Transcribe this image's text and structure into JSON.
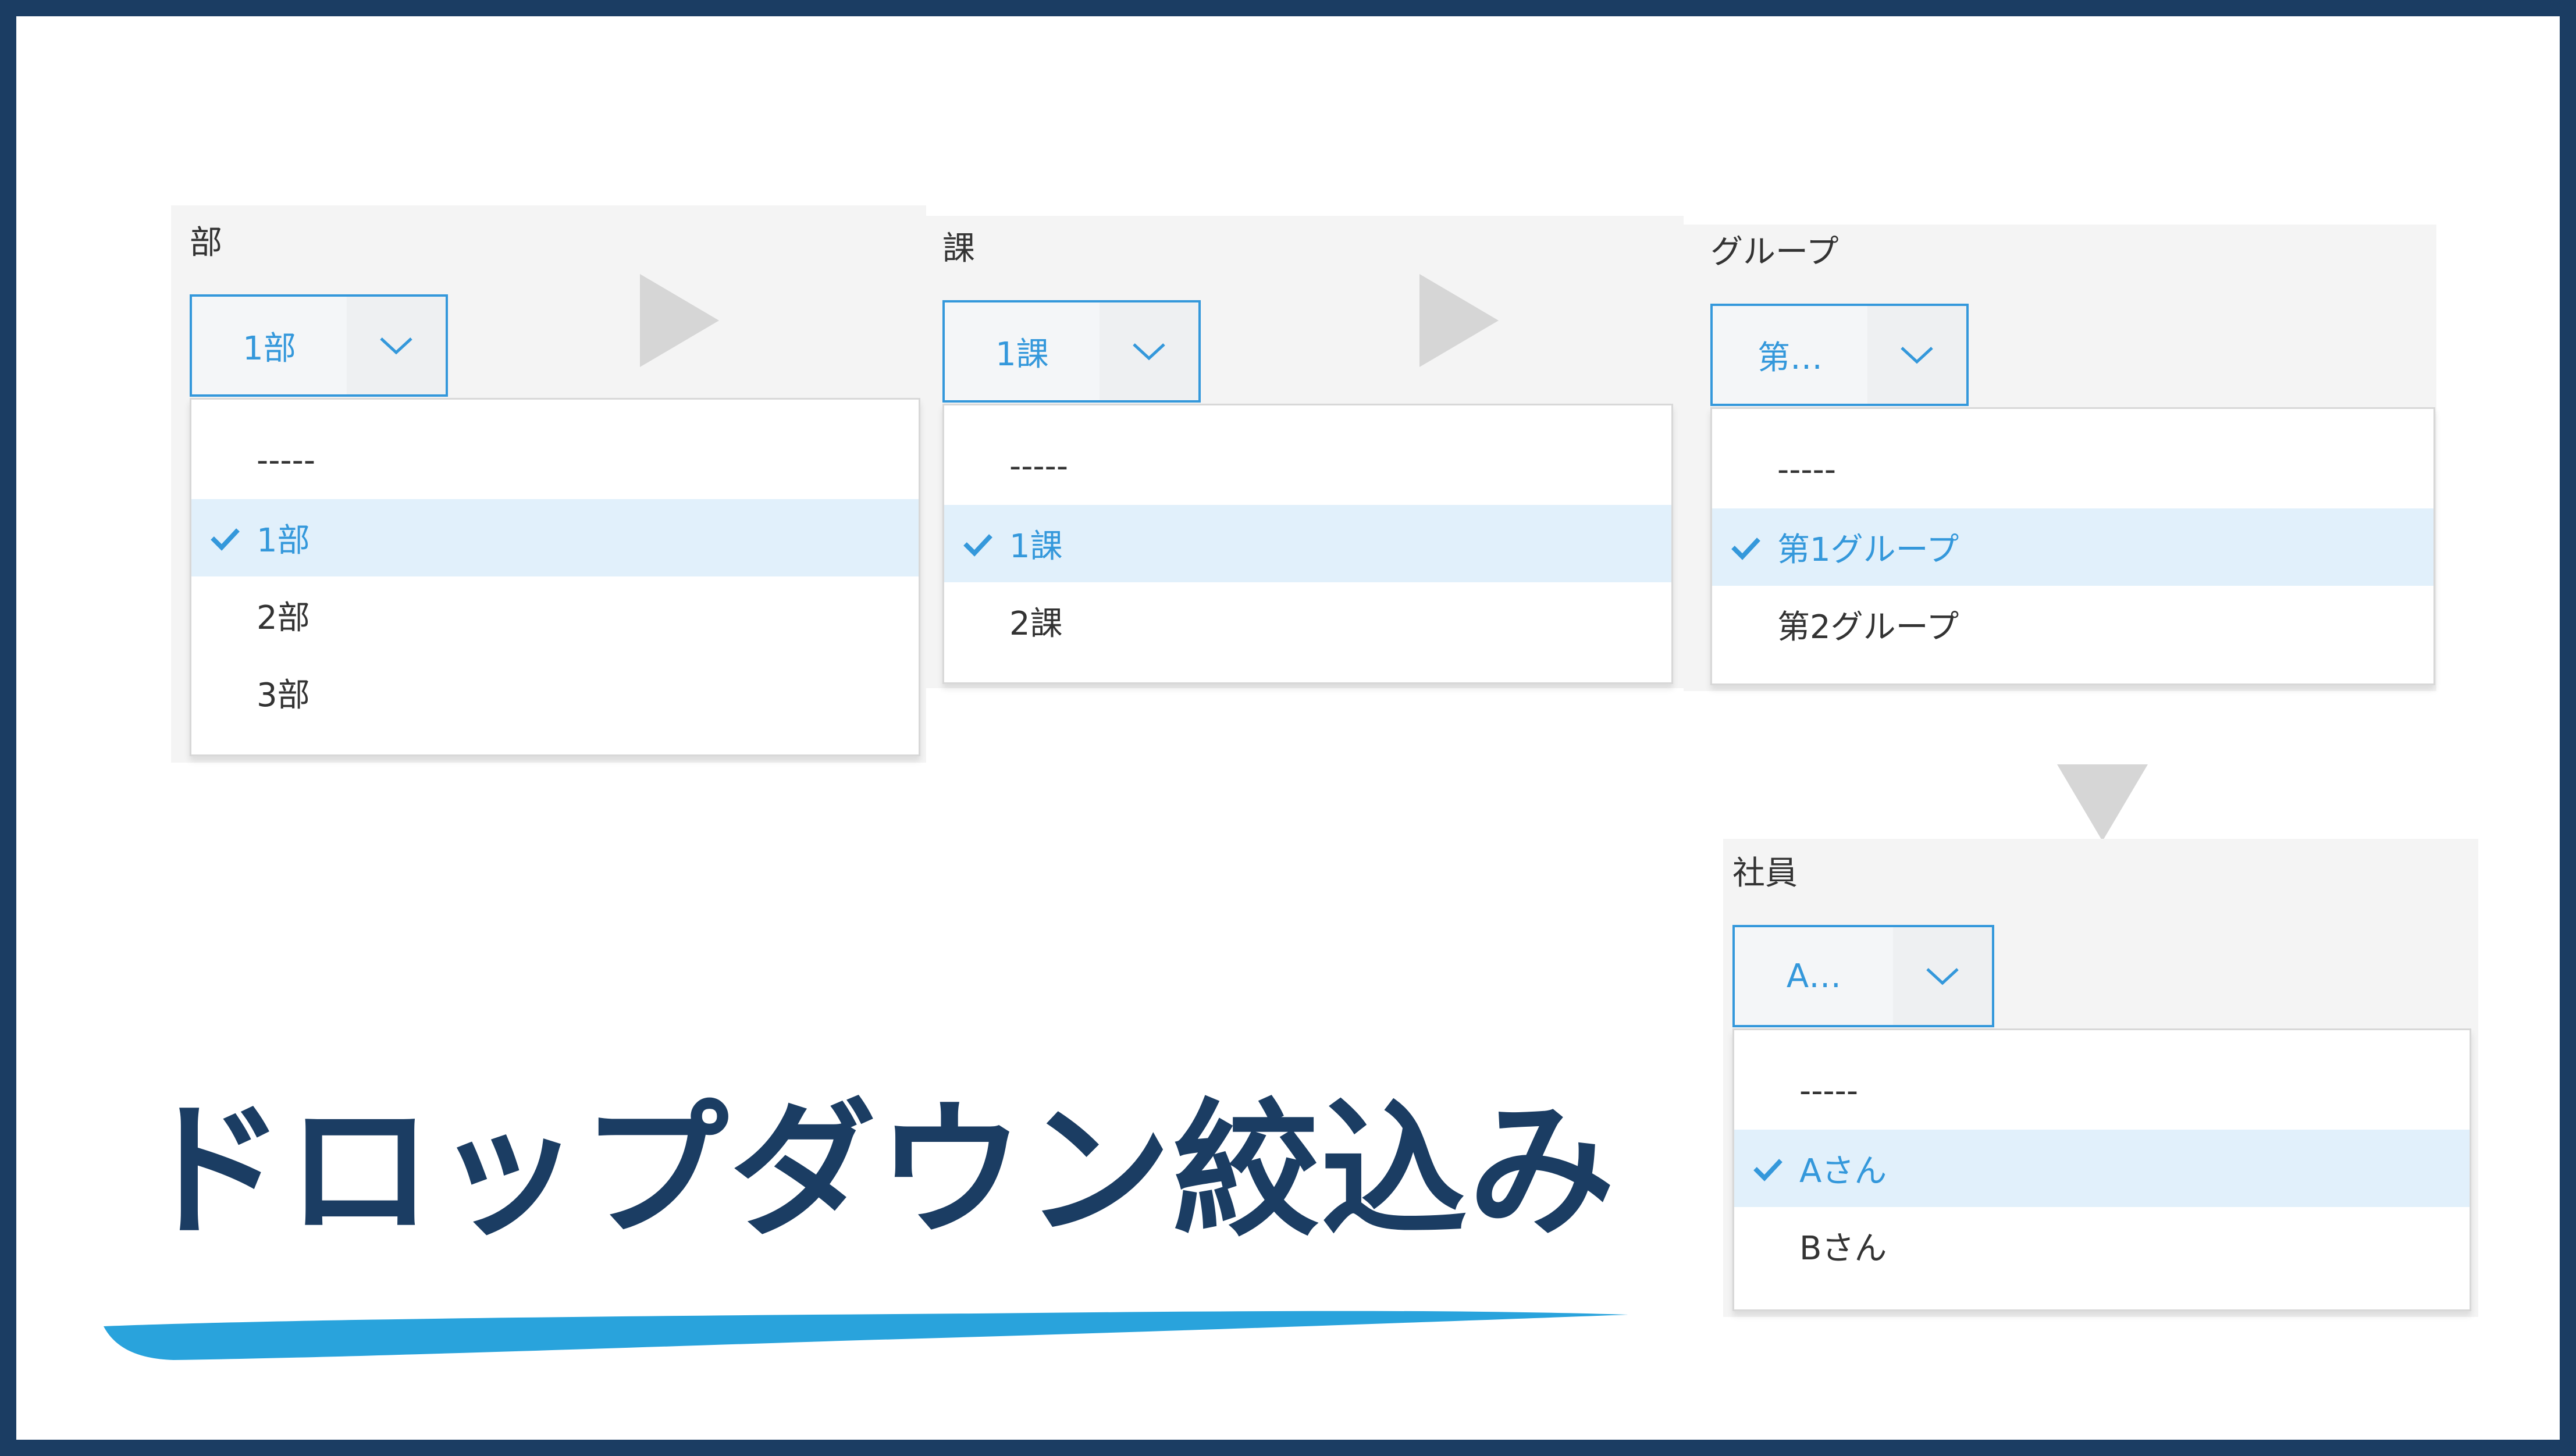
{
  "title": "ドロップダウン絞込み",
  "colors": {
    "frame": "#1b3d63",
    "accent": "#3498db",
    "title": "#1b3d63",
    "underline": "#29a3dc",
    "selected_bg": "#e1f0fb"
  },
  "fields": [
    {
      "label": "部",
      "selected_value": "1部",
      "options": [
        "-----",
        "1部",
        "2部",
        "3部"
      ],
      "selected_index": 1
    },
    {
      "label": "課",
      "selected_value": "1課",
      "options": [
        "-----",
        "1課",
        "2課"
      ],
      "selected_index": 1
    },
    {
      "label": "グループ",
      "selected_value": "第…",
      "options": [
        "-----",
        "第1グループ",
        "第2グループ"
      ],
      "selected_index": 1
    },
    {
      "label": "社員",
      "selected_value": "A…",
      "options": [
        "-----",
        "Aさん",
        "Bさん"
      ],
      "selected_index": 1
    }
  ],
  "icons": {
    "dropdown": "chevron-down-icon",
    "selected": "check-icon",
    "flow_right": "triangle-right-icon",
    "flow_down": "triangle-down-icon"
  }
}
